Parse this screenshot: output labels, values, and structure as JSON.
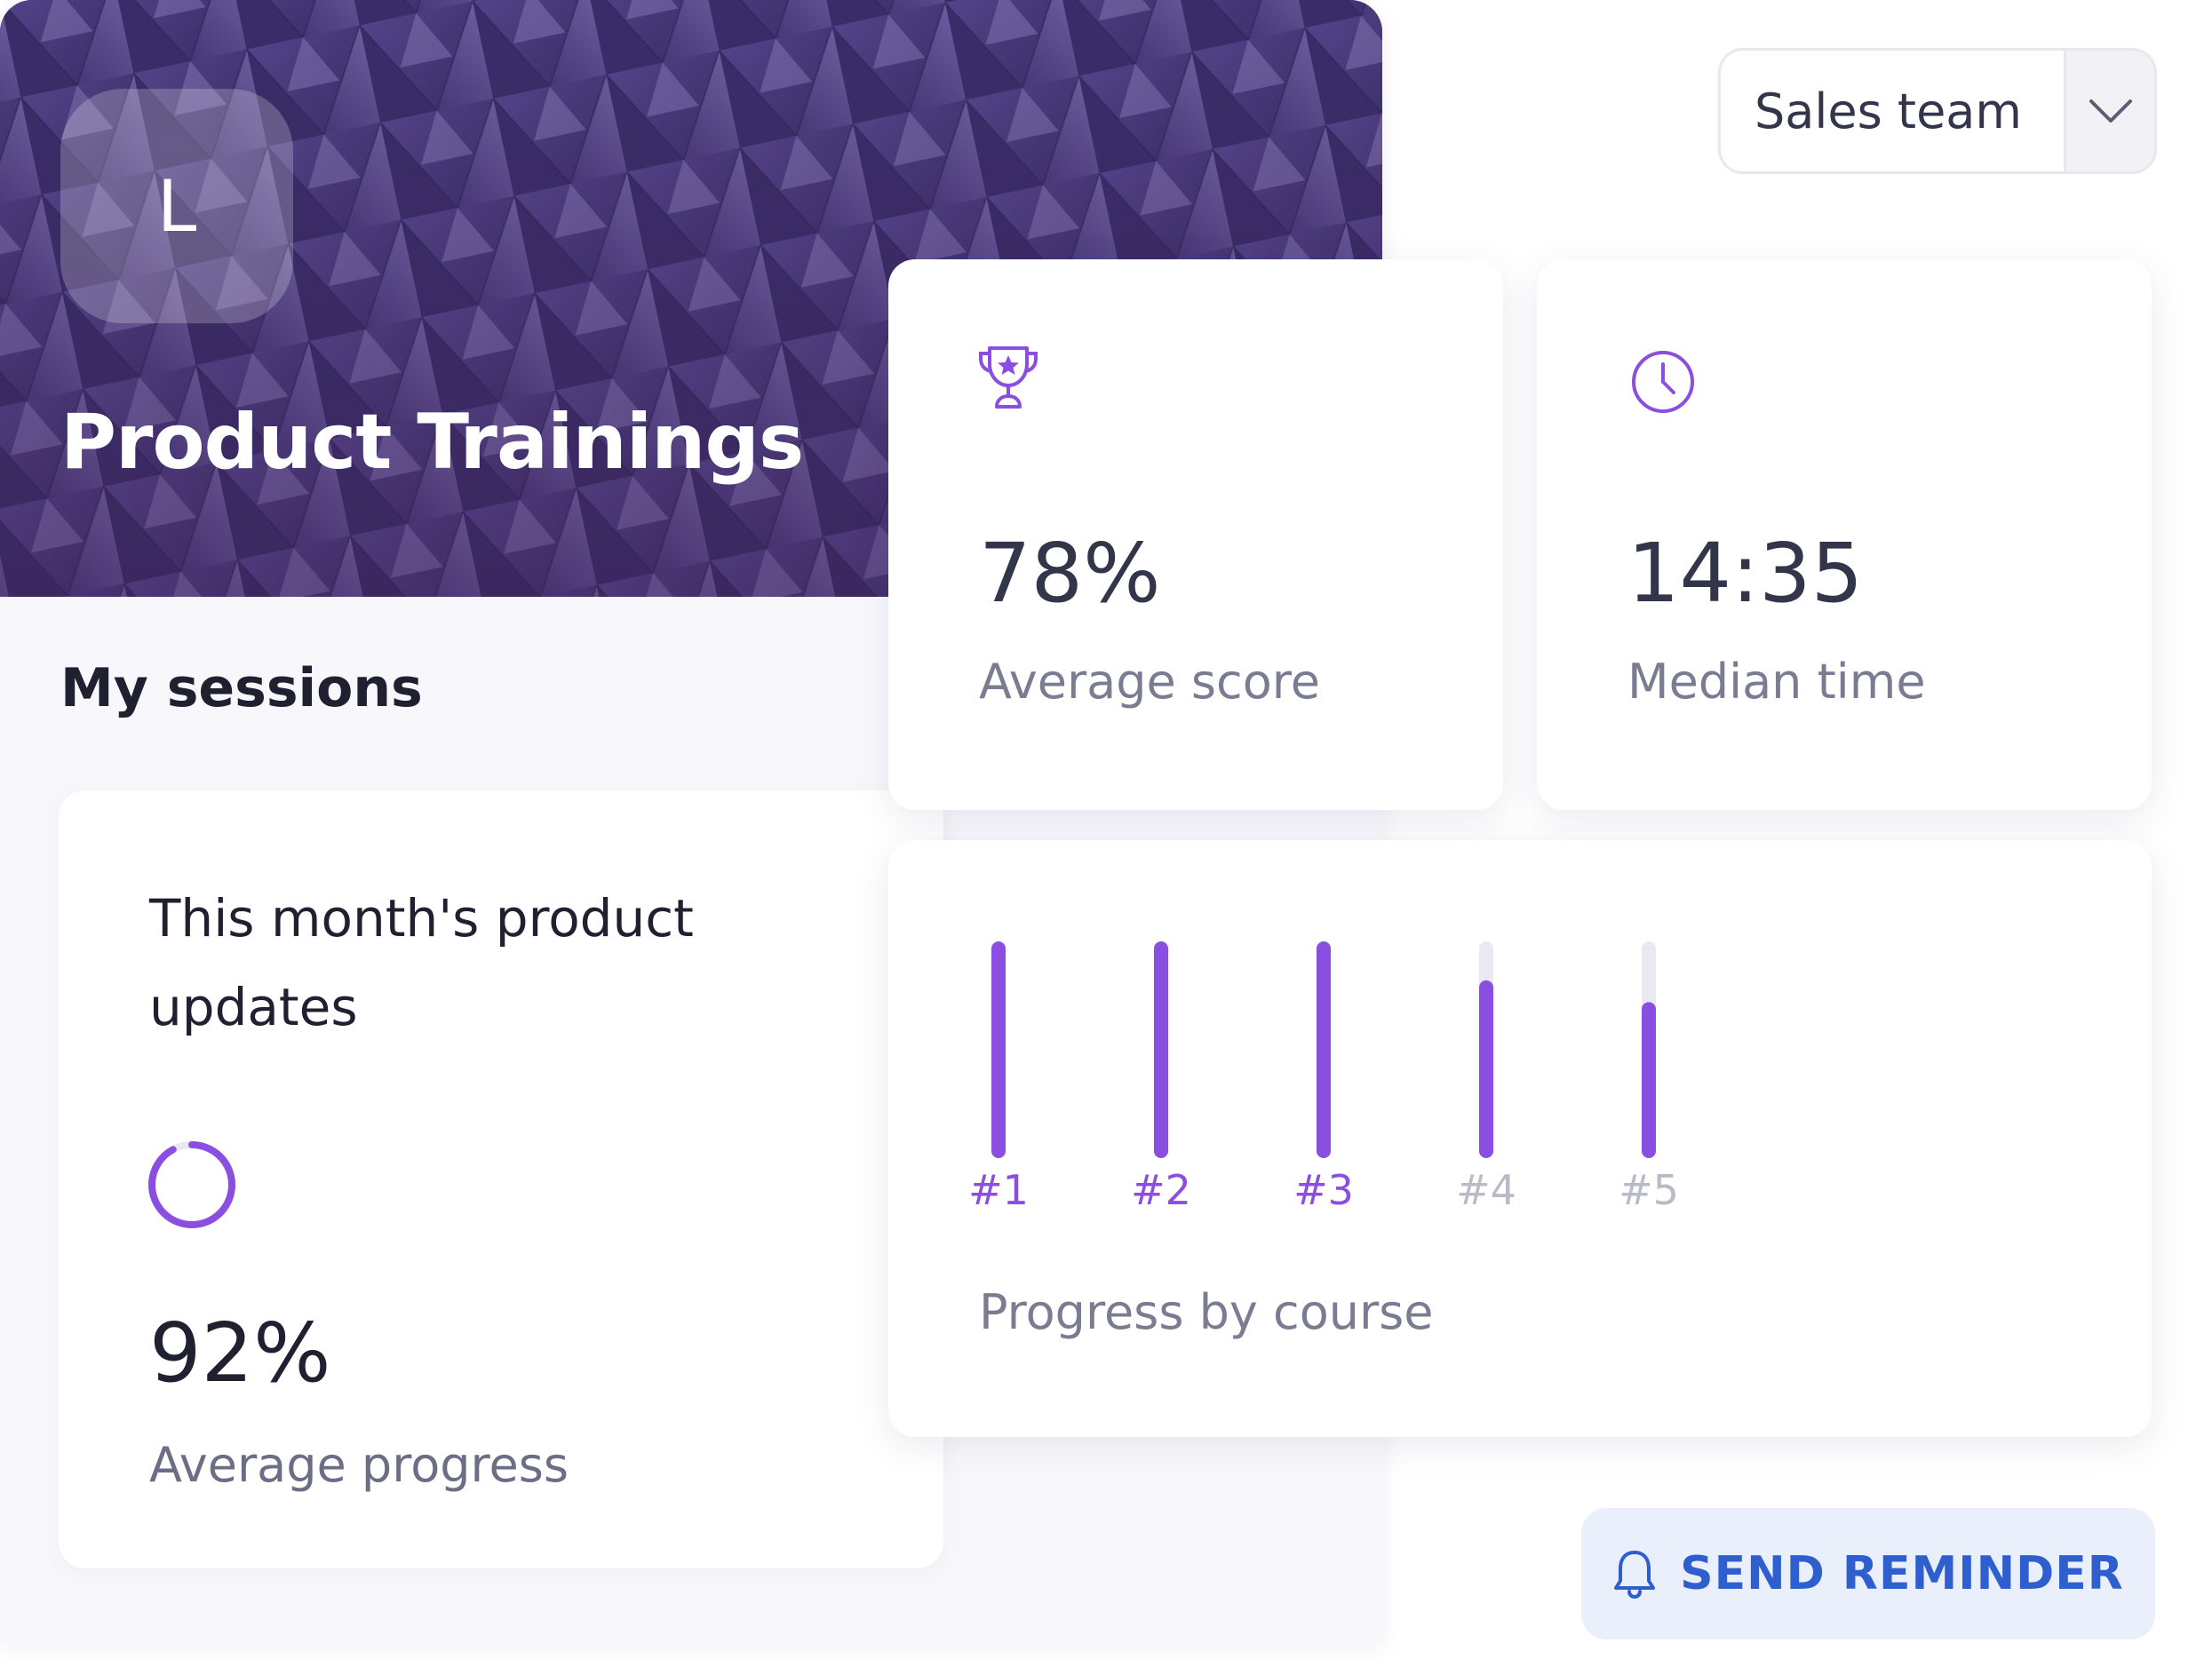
{
  "course": {
    "logo_letter": "L",
    "title": "Product Trainings"
  },
  "sessions": {
    "section_title": "My sessions",
    "card": {
      "title": "This month's product updates",
      "value": "92%",
      "label": "Average progress",
      "progress_fraction": 0.92
    }
  },
  "team_select": {
    "selected": "Sales team"
  },
  "stats": {
    "score": {
      "icon": "trophy-star-icon",
      "value": "78%",
      "label": "Average score"
    },
    "time": {
      "icon": "clock-icon",
      "value": "14:35",
      "label": "Median time"
    }
  },
  "chart_data": {
    "type": "bar",
    "title": "",
    "caption": "Progress by course",
    "categories": [
      "#1",
      "#2",
      "#3",
      "#4",
      "#5"
    ],
    "values": [
      100,
      100,
      100,
      82,
      72
    ],
    "active": [
      true,
      true,
      true,
      false,
      false
    ],
    "ylim": [
      0,
      100
    ],
    "grid": false
  },
  "reminder": {
    "icon": "bell-icon",
    "label": "SEND REMINDER"
  },
  "colors": {
    "accent": "#8a4fe0",
    "track": "#e9e9ef",
    "muted_tick": "#b9bbc6",
    "button_bg": "#eaf0fb",
    "button_text": "#2f5fcf"
  }
}
